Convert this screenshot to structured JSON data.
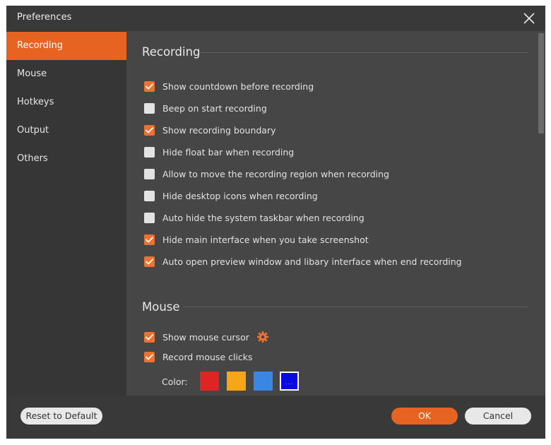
{
  "window": {
    "title": "Preferences"
  },
  "sidebar": {
    "items": [
      {
        "label": "Recording",
        "active": true
      },
      {
        "label": "Mouse",
        "active": false
      },
      {
        "label": "Hotkeys",
        "active": false
      },
      {
        "label": "Output",
        "active": false
      },
      {
        "label": "Others",
        "active": false
      }
    ]
  },
  "recording": {
    "title": "Recording",
    "options": [
      {
        "label": "Show countdown before recording",
        "checked": true
      },
      {
        "label": "Beep on start recording",
        "checked": false
      },
      {
        "label": "Show recording boundary",
        "checked": true
      },
      {
        "label": "Hide float bar when recording",
        "checked": false
      },
      {
        "label": "Allow to move the recording region when recording",
        "checked": false
      },
      {
        "label": "Hide desktop icons when recording",
        "checked": false
      },
      {
        "label": "Auto hide the system taskbar when recording",
        "checked": false
      },
      {
        "label": "Hide main interface when you take screenshot",
        "checked": true
      },
      {
        "label": "Auto open preview window and libary interface when end recording",
        "checked": true
      }
    ]
  },
  "mouse": {
    "title": "Mouse",
    "options": [
      {
        "label": "Show mouse cursor",
        "checked": true
      },
      {
        "label": "Record mouse clicks",
        "checked": true
      }
    ],
    "color_label": "Color:",
    "colors": [
      {
        "hex": "#e02424",
        "selected": false
      },
      {
        "hex": "#f5a717",
        "selected": false
      },
      {
        "hex": "#3a86e4",
        "selected": false
      },
      {
        "hex": "#0a0ae0",
        "selected": true
      }
    ],
    "custom_color_glyph": "..."
  },
  "footer": {
    "reset_label": "Reset to Default",
    "ok_label": "OK",
    "cancel_label": "Cancel"
  },
  "theme": {
    "accent": "#e76321",
    "checkbox_on": "#ec7233",
    "checkbox_off": "#e3e3e3"
  }
}
